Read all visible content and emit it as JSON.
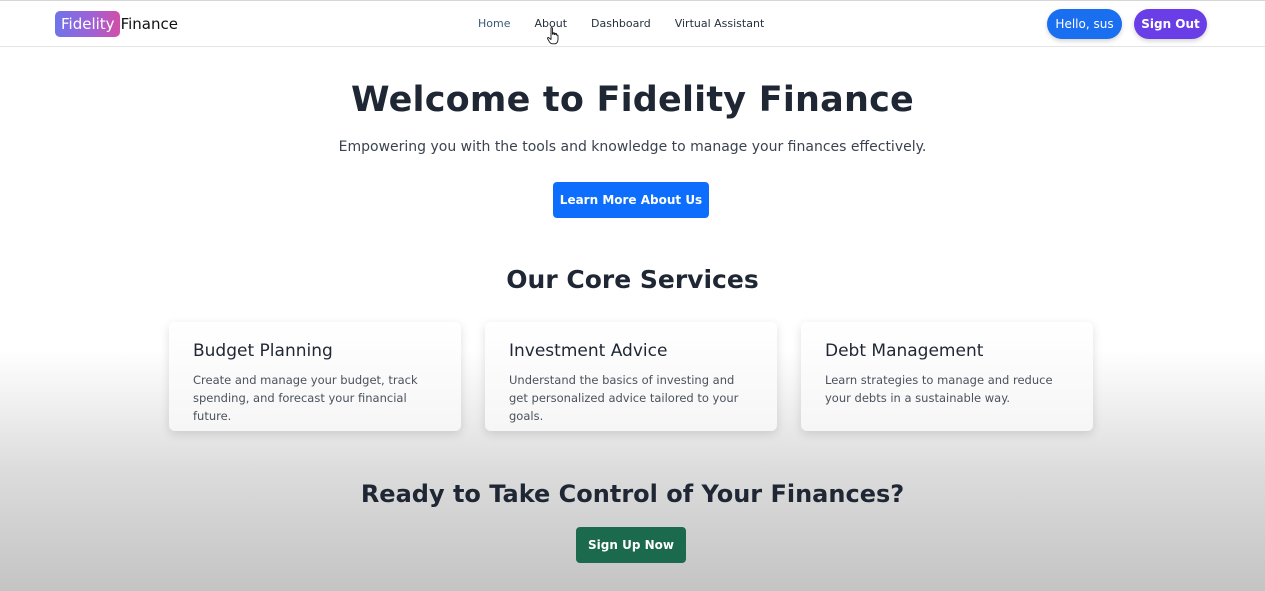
{
  "navbar": {
    "brand_badge": "Fidelity",
    "brand_word": "Finance",
    "links": [
      "Home",
      "About",
      "Dashboard",
      "Virtual Assistant"
    ],
    "greeting": "Hello, sus",
    "sign_out": "Sign Out"
  },
  "hero": {
    "title": "Welcome to Fidelity Finance",
    "subtitle": "Empowering you with the tools and knowledge to manage your finances effectively.",
    "cta": "Learn More About Us"
  },
  "services": {
    "title": "Our Core Services",
    "cards": [
      {
        "title": "Budget Planning",
        "text": "Create and manage your budget, track spending, and forecast your financial future."
      },
      {
        "title": "Investment Advice",
        "text": "Understand the basics of investing and get personalized advice tailored to your goals."
      },
      {
        "title": "Debt Management",
        "text": "Learn strategies to manage and reduce your debts in a sustainable way."
      }
    ]
  },
  "cta": {
    "title": "Ready to Take Control of Your Finances?",
    "button": "Sign Up Now"
  },
  "colors": {
    "primary": "#0d6efd",
    "hello_button": "#1a6ef0",
    "sign_out_button": "#6a3ee6",
    "sign_up_button": "#1b6a4d",
    "brand_gradient_start": "#6f74ea",
    "brand_gradient_end": "#d24fa8"
  },
  "icons": {
    "cursor": "hand-pointer-icon"
  }
}
